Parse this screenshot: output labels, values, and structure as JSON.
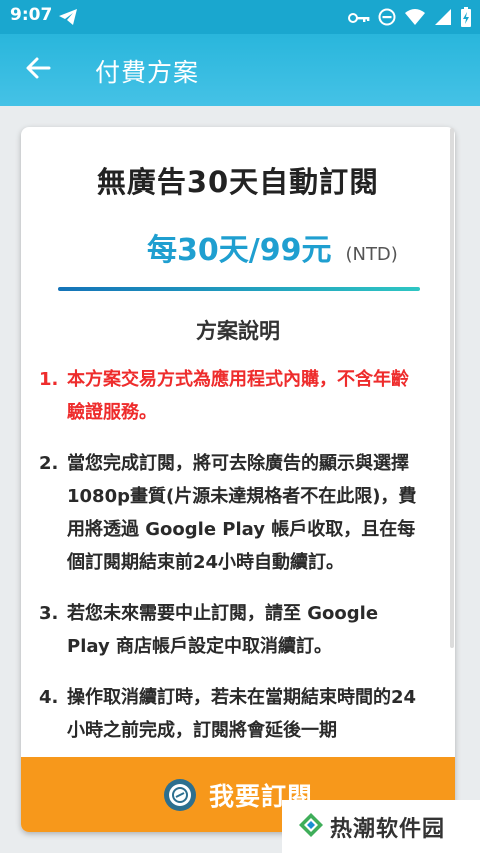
{
  "status_bar": {
    "time": "9:07",
    "icons": [
      "telegram-icon",
      "key-icon",
      "dnd-icon",
      "wifi-icon",
      "signal-icon",
      "battery-icon"
    ]
  },
  "app_bar": {
    "back_icon": "arrow-left-icon",
    "title": "付費方案"
  },
  "plan": {
    "title": "無廣告30天自動訂閱",
    "price": "每30天/99元",
    "currency": "(NTD)"
  },
  "section_title": "方案說明",
  "terms": [
    {
      "num": "1.",
      "text": "本方案交易方式為應用程式內購，不含年齡驗證服務。",
      "highlight": true
    },
    {
      "num": "2.",
      "text": "當您完成訂閱，將可去除廣告的顯示與選擇1080p畫質(片源未達規格者不在此限)，費用將透過 Google Play 帳戶收取，且在每個訂閱期結束前24小時自動續訂。",
      "highlight": false
    },
    {
      "num": "3.",
      "text": "若您未來需要中止訂閱，請至 Google Play 商店帳戶設定中取消續訂。",
      "highlight": false
    },
    {
      "num": "4.",
      "text": "操作取消續訂時，若未在當期結束時間的24小時之前完成，訂閱將會延後一期",
      "highlight": false
    }
  ],
  "subscribe_button": {
    "label": "我要訂閱",
    "icon": "subscribe-badge-icon"
  },
  "watermark": {
    "text": "热潮软件园"
  },
  "colors": {
    "appbar": "#29b6dc",
    "price": "#1f9fd0",
    "warning": "#ee2c2c",
    "button": "#f7981b"
  }
}
